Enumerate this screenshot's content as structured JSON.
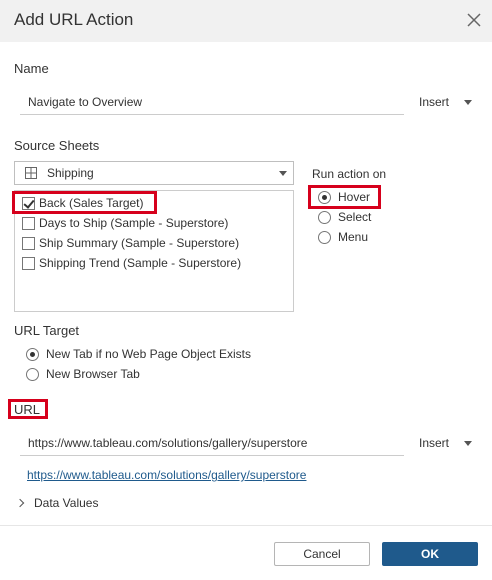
{
  "dialog": {
    "title": "Add URL Action"
  },
  "name_section": {
    "label": "Name",
    "value": "Navigate to Overview",
    "insert_label": "Insert"
  },
  "source_sheets": {
    "label": "Source Sheets",
    "selected_data_source": "Shipping",
    "sheets": [
      {
        "label": "Back (Sales Target)",
        "checked": true
      },
      {
        "label": "Days to Ship (Sample - Superstore)",
        "checked": false
      },
      {
        "label": "Ship Summary (Sample - Superstore)",
        "checked": false
      },
      {
        "label": "Shipping Trend (Sample - Superstore)",
        "checked": false
      }
    ]
  },
  "run_action": {
    "label": "Run action on",
    "options": [
      {
        "label": "Hover",
        "selected": true
      },
      {
        "label": "Select",
        "selected": false
      },
      {
        "label": "Menu",
        "selected": false
      }
    ]
  },
  "url_target": {
    "label": "URL Target",
    "options": [
      {
        "label": "New Tab if no Web Page Object Exists",
        "selected": true
      },
      {
        "label": "New Browser Tab",
        "selected": false
      }
    ]
  },
  "url_section": {
    "label": "URL",
    "value": "https://www.tableau.com/solutions/gallery/superstore",
    "insert_label": "Insert",
    "preview_link": "https://www.tableau.com/solutions/gallery/superstore"
  },
  "data_values": {
    "label": "Data Values"
  },
  "footer": {
    "cancel_label": "Cancel",
    "ok_label": "OK"
  },
  "colors": {
    "accent": "#1f5a8c",
    "highlight": "#d6001c",
    "header_bg": "#f1f1f1"
  },
  "icons": [
    "close-icon",
    "grid-icon",
    "chevron-down-icon",
    "chevron-right-icon"
  ]
}
